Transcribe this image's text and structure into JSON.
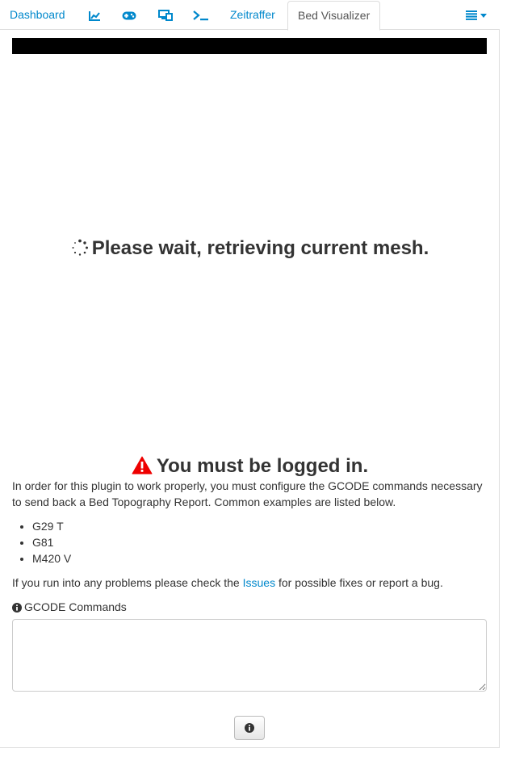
{
  "tabs": {
    "dashboard": "Dashboard",
    "graph_icon": "chart-line-icon",
    "gamepad_icon": "gamepad-icon",
    "devices_icon": "devices-icon",
    "terminal_icon": "terminal-icon",
    "timelapse": "Zeitraffer",
    "active": "Bed Visualizer",
    "menu_icon": "list-menu-icon"
  },
  "status": {
    "wait_message": "Please wait, retrieving current mesh.",
    "login_message": "You must be logged in."
  },
  "content": {
    "description": "In order for this plugin to work properly, you must configure the GCODE commands necessary to send back a Bed Topography Report. Common examples are listed below.",
    "examples": [
      "G29 T",
      "G81",
      "M420 V"
    ],
    "issues_prefix": "If you run into any problems please check the ",
    "issues_link": "Issues",
    "issues_suffix": " for possible fixes or report a bug.",
    "gcode_label": "GCODE Commands",
    "gcode_value": ""
  },
  "colors": {
    "link": "#0088cc",
    "warning": "#ee0000",
    "bar": "#000000"
  }
}
